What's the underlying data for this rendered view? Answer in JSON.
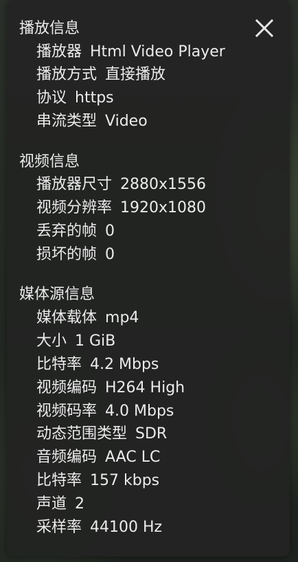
{
  "sections": [
    {
      "title": "播放信息",
      "rows": [
        {
          "label": "播放器",
          "value": "Html Video Player"
        },
        {
          "label": "播放方式",
          "value": "直接播放"
        },
        {
          "label": "协议",
          "value": "https"
        },
        {
          "label": "串流类型",
          "value": "Video"
        }
      ]
    },
    {
      "title": "视频信息",
      "rows": [
        {
          "label": "播放器尺寸",
          "value": "2880x1556"
        },
        {
          "label": "视频分辨率",
          "value": "1920x1080"
        },
        {
          "label": "丢弃的帧",
          "value": "0"
        },
        {
          "label": "损坏的帧",
          "value": "0"
        }
      ]
    },
    {
      "title": "媒体源信息",
      "rows": [
        {
          "label": "媒体载体",
          "value": "mp4"
        },
        {
          "label": "大小",
          "value": "1 GiB"
        },
        {
          "label": "比特率",
          "value": "4.2 Mbps"
        },
        {
          "label": "视频编码",
          "value": "H264 High"
        },
        {
          "label": "视频码率",
          "value": "4.0 Mbps"
        },
        {
          "label": "动态范围类型",
          "value": "SDR"
        },
        {
          "label": "音频编码",
          "value": "AAC LC"
        },
        {
          "label": "比特率",
          "value": "157 kbps"
        },
        {
          "label": "声道",
          "value": "2"
        },
        {
          "label": "采样率",
          "value": "44100 Hz"
        }
      ]
    }
  ],
  "icons": {
    "close": "close-icon"
  },
  "colors": {
    "panel_bg": "#232523",
    "text": "#ececec"
  }
}
